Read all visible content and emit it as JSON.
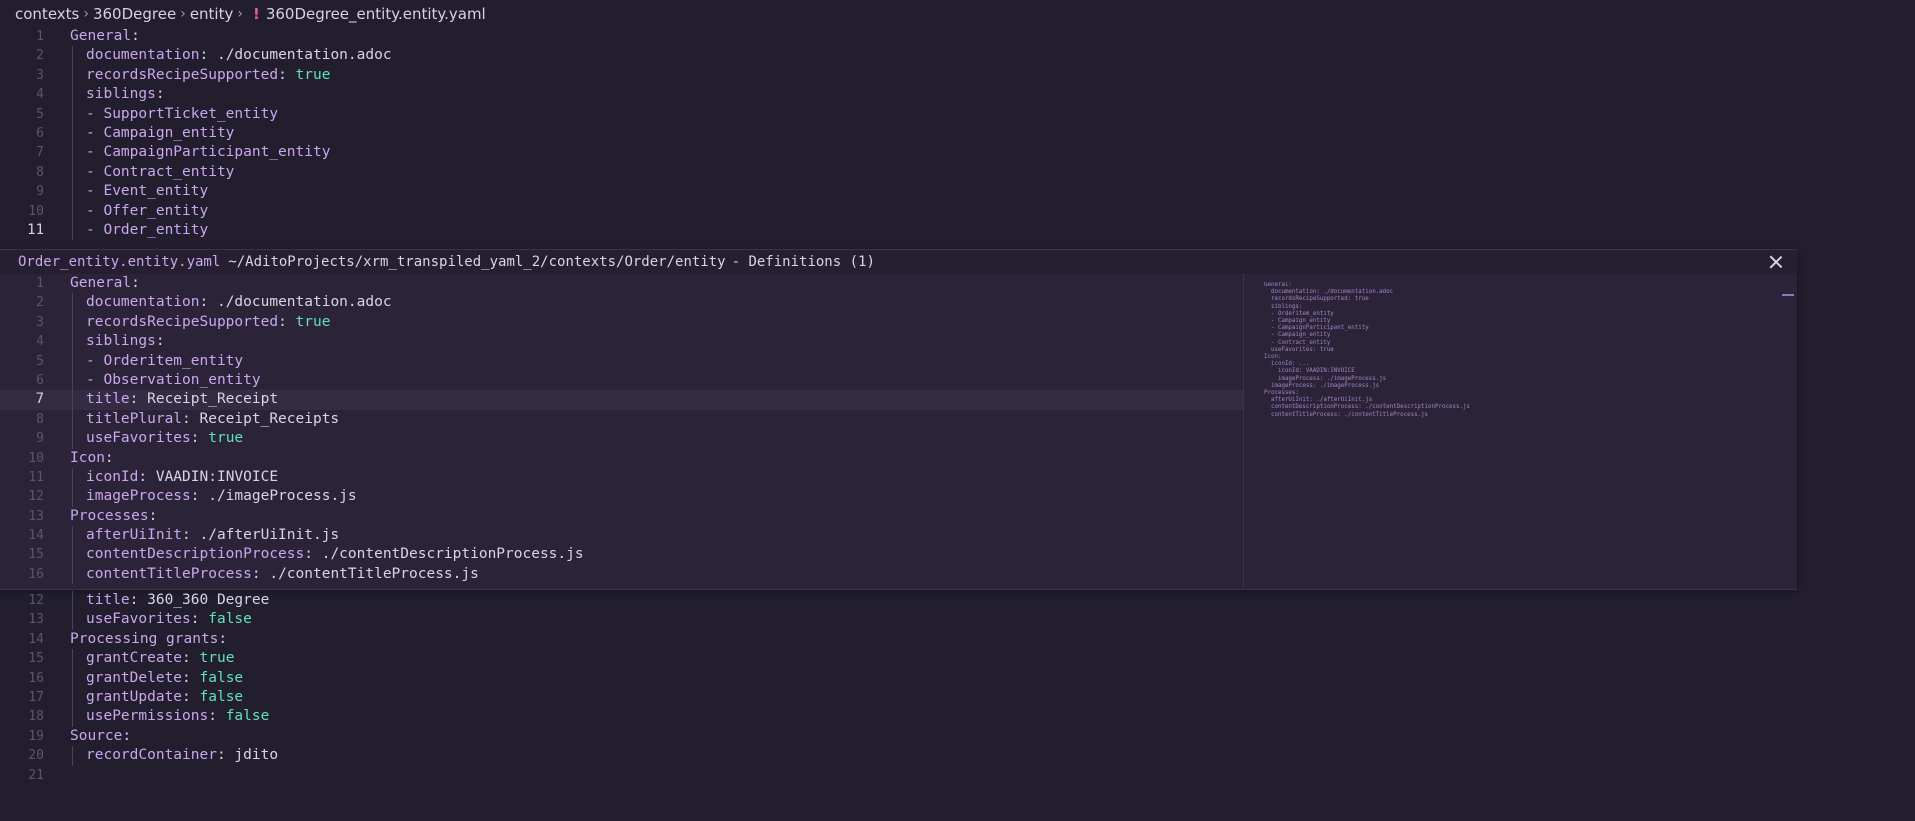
{
  "breadcrumb": {
    "items": [
      "contexts",
      "360Degree",
      "entity"
    ],
    "file_icon": "!",
    "file": "360Degree_entity.entity.yaml"
  },
  "editor_top": [
    {
      "n": "1",
      "parts": [
        {
          "t": "General",
          "c": "k"
        },
        {
          "t": ":",
          "c": "p"
        }
      ],
      "indent": 0
    },
    {
      "n": "2",
      "parts": [
        {
          "t": "documentation",
          "c": "k"
        },
        {
          "t": ": ./documentation.adoc",
          "c": "v"
        }
      ],
      "indent": 1
    },
    {
      "n": "3",
      "parts": [
        {
          "t": "recordsRecipeSupported",
          "c": "k"
        },
        {
          "t": ": ",
          "c": "p"
        },
        {
          "t": "true",
          "c": "b"
        }
      ],
      "indent": 1
    },
    {
      "n": "4",
      "parts": [
        {
          "t": "siblings",
          "c": "k"
        },
        {
          "t": ":",
          "c": "p"
        }
      ],
      "indent": 1
    },
    {
      "n": "5",
      "parts": [
        {
          "t": "- SupportTicket_entity",
          "c": "k"
        }
      ],
      "indent": 1
    },
    {
      "n": "6",
      "parts": [
        {
          "t": "- Campaign_entity",
          "c": "k"
        }
      ],
      "indent": 1
    },
    {
      "n": "7",
      "parts": [
        {
          "t": "- CampaignParticipant_entity",
          "c": "k"
        }
      ],
      "indent": 1
    },
    {
      "n": "8",
      "parts": [
        {
          "t": "- Contract_entity",
          "c": "k"
        }
      ],
      "indent": 1
    },
    {
      "n": "9",
      "parts": [
        {
          "t": "- Event_entity",
          "c": "k"
        }
      ],
      "indent": 1
    },
    {
      "n": "10",
      "parts": [
        {
          "t": "- Offer_entity",
          "c": "k"
        }
      ],
      "indent": 1
    },
    {
      "n": "11",
      "parts": [
        {
          "t": "- Order_entity",
          "c": "k"
        }
      ],
      "indent": 1,
      "active": true
    }
  ],
  "peek": {
    "file": "Order_entity.entity.yaml",
    "path": "~/AditoProjects/xrm_transpiled_yaml_2/contexts/Order/entity",
    "count": "- Definitions (1)",
    "lines": [
      {
        "n": "1",
        "parts": [
          {
            "t": "General",
            "c": "k"
          },
          {
            "t": ":",
            "c": "p"
          }
        ],
        "indent": 0
      },
      {
        "n": "2",
        "parts": [
          {
            "t": "documentation",
            "c": "k"
          },
          {
            "t": ": ./documentation.adoc",
            "c": "v"
          }
        ],
        "indent": 1
      },
      {
        "n": "3",
        "parts": [
          {
            "t": "recordsRecipeSupported",
            "c": "k"
          },
          {
            "t": ": ",
            "c": "p"
          },
          {
            "t": "true",
            "c": "b"
          }
        ],
        "indent": 1
      },
      {
        "n": "4",
        "parts": [
          {
            "t": "siblings",
            "c": "k"
          },
          {
            "t": ":",
            "c": "p"
          }
        ],
        "indent": 1
      },
      {
        "n": "5",
        "parts": [
          {
            "t": "- Orderitem_entity",
            "c": "k"
          }
        ],
        "indent": 1
      },
      {
        "n": "6",
        "parts": [
          {
            "t": "- Observation_entity",
            "c": "k"
          }
        ],
        "indent": 1
      },
      {
        "n": "7",
        "parts": [
          {
            "t": "title",
            "c": "k"
          },
          {
            "t": ": Receipt_Receipt",
            "c": "v"
          }
        ],
        "indent": 1,
        "active": true
      },
      {
        "n": "8",
        "parts": [
          {
            "t": "titlePlural",
            "c": "k"
          },
          {
            "t": ": Receipt_Receipts",
            "c": "v"
          }
        ],
        "indent": 1
      },
      {
        "n": "9",
        "parts": [
          {
            "t": "useFavorites",
            "c": "k"
          },
          {
            "t": ": ",
            "c": "p"
          },
          {
            "t": "true",
            "c": "b"
          }
        ],
        "indent": 1
      },
      {
        "n": "10",
        "parts": [
          {
            "t": "Icon",
            "c": "k"
          },
          {
            "t": ":",
            "c": "p"
          }
        ],
        "indent": 0
      },
      {
        "n": "11",
        "parts": [
          {
            "t": "iconId",
            "c": "k"
          },
          {
            "t": ": VAADIN:INVOICE",
            "c": "v"
          }
        ],
        "indent": 1
      },
      {
        "n": "12",
        "parts": [
          {
            "t": "imageProcess",
            "c": "k"
          },
          {
            "t": ": ./imageProcess.js",
            "c": "v"
          }
        ],
        "indent": 1
      },
      {
        "n": "13",
        "parts": [
          {
            "t": "Processes",
            "c": "k"
          },
          {
            "t": ":",
            "c": "p"
          }
        ],
        "indent": 0
      },
      {
        "n": "14",
        "parts": [
          {
            "t": "afterUiInit",
            "c": "k"
          },
          {
            "t": ": ./afterUiInit.js",
            "c": "v"
          }
        ],
        "indent": 1
      },
      {
        "n": "15",
        "parts": [
          {
            "t": "contentDescriptionProcess",
            "c": "k"
          },
          {
            "t": ": ./contentDescriptionProcess.js",
            "c": "v"
          }
        ],
        "indent": 1
      },
      {
        "n": "16",
        "parts": [
          {
            "t": "contentTitleProcess",
            "c": "k"
          },
          {
            "t": ": ./contentTitleProcess.js",
            "c": "v"
          }
        ],
        "indent": 1
      }
    ]
  },
  "editor_bottom": [
    {
      "n": "12",
      "parts": [
        {
          "t": "title",
          "c": "k"
        },
        {
          "t": ": 360_360 Degree",
          "c": "v"
        }
      ],
      "indent": 1
    },
    {
      "n": "13",
      "parts": [
        {
          "t": "useFavorites",
          "c": "k"
        },
        {
          "t": ": ",
          "c": "p"
        },
        {
          "t": "false",
          "c": "b"
        }
      ],
      "indent": 1
    },
    {
      "n": "14",
      "parts": [
        {
          "t": "Processing grants",
          "c": "k"
        },
        {
          "t": ":",
          "c": "p"
        }
      ],
      "indent": 0
    },
    {
      "n": "15",
      "parts": [
        {
          "t": "grantCreate",
          "c": "k"
        },
        {
          "t": ": ",
          "c": "p"
        },
        {
          "t": "true",
          "c": "b"
        }
      ],
      "indent": 1
    },
    {
      "n": "16",
      "parts": [
        {
          "t": "grantDelete",
          "c": "k"
        },
        {
          "t": ": ",
          "c": "p"
        },
        {
          "t": "false",
          "c": "b"
        }
      ],
      "indent": 1
    },
    {
      "n": "17",
      "parts": [
        {
          "t": "grantUpdate",
          "c": "k"
        },
        {
          "t": ": ",
          "c": "p"
        },
        {
          "t": "false",
          "c": "b"
        }
      ],
      "indent": 1
    },
    {
      "n": "18",
      "parts": [
        {
          "t": "usePermissions",
          "c": "k"
        },
        {
          "t": ": ",
          "c": "p"
        },
        {
          "t": "false",
          "c": "b"
        }
      ],
      "indent": 1
    },
    {
      "n": "19",
      "parts": [
        {
          "t": "Source",
          "c": "k"
        },
        {
          "t": ":",
          "c": "p"
        }
      ],
      "indent": 0
    },
    {
      "n": "20",
      "parts": [
        {
          "t": "recordContainer",
          "c": "k"
        },
        {
          "t": ": jdito",
          "c": "v"
        }
      ],
      "indent": 1
    },
    {
      "n": "21",
      "parts": [],
      "indent": 0
    }
  ],
  "minimap_text": "General:\n  documentation: ./documentation.adoc\n  recordsRecipeSupported: true\n  siblings:\n  - Orderitem_entity\n  - Campaign_entity\n  - CampaignParticipant_entity\n  - Campaign_entity\n  - Contract_entity\n  useFavorites: true\nIcon:\n  iconId: ...\n    iconId: VAADIN:INVOICE\n    imageProcess: ./imageProcess.js\n  imageProcess: ./imageProcess.js\nProcesses:\n  afterUiInit: ./afterUiInit.js\n  contentDescriptionProcess: ./contentDescriptionProcess.js\n  contentTitleProcess: ./contentTitleProcess.js",
  "colors": {
    "background": "#221e2d",
    "key": "#c9a6ee",
    "bool": "#5fe3b8",
    "peek_bg": "#2b2438",
    "yaml_icon": "#e45f8a"
  }
}
